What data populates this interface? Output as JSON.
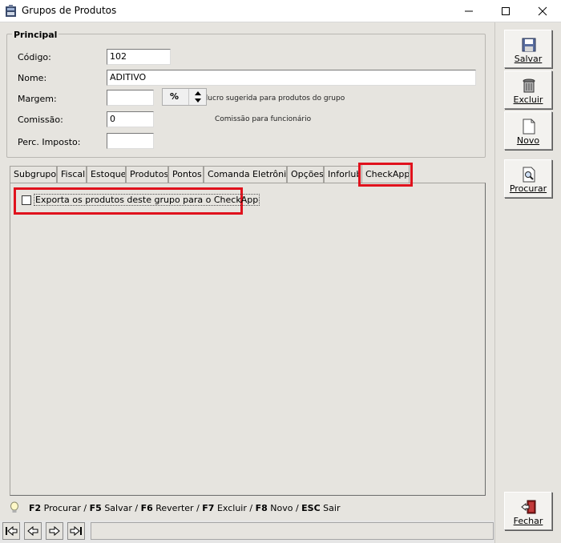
{
  "window": {
    "title": "Grupos de Produtos"
  },
  "principal": {
    "legend": "Principal",
    "codigo_label": "Código:",
    "codigo_value": "102",
    "nome_label": "Nome:",
    "nome_value": "ADITIVO",
    "margem_label": "Margem:",
    "margem_value": "",
    "margem_hint": "Margem de lucro sugerida para produtos do grupo",
    "comissao_label": "Comissão:",
    "comissao_value": "0",
    "comissao_unit": "%",
    "comissao_hint": "Comissão para funcionário",
    "imposto_label": "Perc. Imposto:",
    "imposto_value": ""
  },
  "tabs": [
    "Subgrupos",
    "Fiscal",
    "Estoque",
    "Produtos",
    "Pontos",
    "Comanda Eletrônica",
    "Opções",
    "Inforlub",
    "CheckApp"
  ],
  "active_tab": "CheckApp",
  "checkapp": {
    "export_label": "Exporta os produtos deste grupo para o CheckApp",
    "export_checked": false
  },
  "shortcuts": {
    "f2_key": "F2",
    "f2_label": "Procurar",
    "f5_key": "F5",
    "f5_label": "Salvar",
    "f6_key": "F6",
    "f6_label": "Reverter",
    "f7_key": "F7",
    "f7_label": "Excluir",
    "f8_key": "F8",
    "f8_label": "Novo",
    "esc_key": "ESC",
    "esc_label": "Sair",
    "sep": " / "
  },
  "side_buttons": {
    "salvar": "Salvar",
    "excluir": "Excluir",
    "novo": "Novo",
    "procurar": "Procurar",
    "fechar": "Fechar"
  },
  "colors": {
    "highlight": "#e0121d",
    "background": "#e6e4df"
  },
  "icons": {
    "save": "floppy-disk-icon",
    "delete": "trash-can-icon",
    "new": "document-icon",
    "search": "magnifier-document-icon",
    "close": "exit-door-icon",
    "nav_first": "first-record-icon",
    "nav_prev": "previous-record-icon",
    "nav_next": "next-record-icon",
    "nav_last": "last-record-icon"
  }
}
